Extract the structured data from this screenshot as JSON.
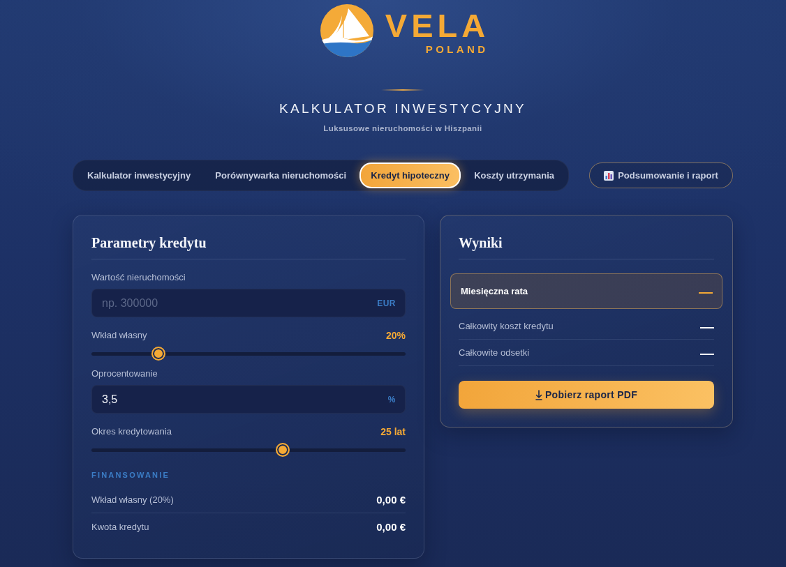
{
  "brand": {
    "name": "VELA",
    "tagline": "POLAND"
  },
  "header": {
    "title": "KALKULATOR INWESTYCYJNY",
    "subtitle": "Luksusowe nieruchomości w Hiszpanii"
  },
  "tabs": [
    {
      "label": "Kalkulator inwestycyjny",
      "selected": false
    },
    {
      "label": "Porównywarka nieruchomości",
      "selected": false
    },
    {
      "label": "Kredyt hipoteczny",
      "selected": true
    },
    {
      "label": "Koszty utrzymania",
      "selected": false
    }
  ],
  "summary_button": {
    "label": "Podsumowanie i raport"
  },
  "parameters_panel": {
    "title": "Parametry kredytu",
    "fields": [
      {
        "kind": "input",
        "label": "Wartość nieruchomości",
        "placeholder": "np. 300000",
        "unit": "EUR"
      },
      {
        "kind": "slider",
        "label": "Wkład własny",
        "reading": "20%",
        "level": 0.2
      },
      {
        "kind": "input",
        "label": "Oprocentowanie",
        "value": "3,5",
        "unit": "%"
      },
      {
        "kind": "slider",
        "label": "Okres kredytowania",
        "reading": "25 lat",
        "level": 0.615
      }
    ],
    "financing": {
      "heading": "FINANSOWANIE",
      "rows": [
        {
          "label": "Wkład własny (20%)",
          "value": "0,00 €"
        },
        {
          "label": "Kwota kredytu",
          "value": "0,00 €"
        }
      ]
    }
  },
  "results_panel": {
    "title": "Wyniki",
    "rows": [
      {
        "label": "Miesięczna rata",
        "value": "—",
        "highlighted": true
      },
      {
        "label": "Całkowity koszt kredytu",
        "value": "—",
        "highlighted": false
      },
      {
        "label": "Całkowite odsetki",
        "value": "—",
        "highlighted": false
      }
    ],
    "download_button": {
      "label": "Pobierz raport PDF"
    }
  }
}
